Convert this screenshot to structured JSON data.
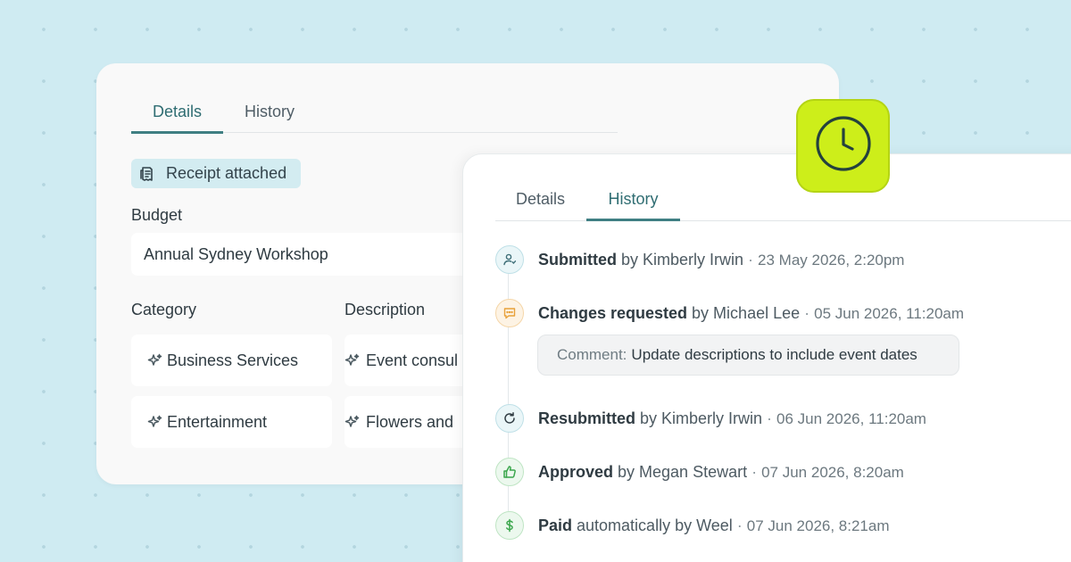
{
  "back_card": {
    "tabs": [
      {
        "label": "Details",
        "active": true
      },
      {
        "label": "History",
        "active": false
      }
    ],
    "receipt_badge": "Receipt attached",
    "budget_label": "Budget",
    "budget_value": "Annual Sydney Workshop",
    "category_label": "Category",
    "description_label": "Description",
    "rows": [
      {
        "category": "Business Services",
        "description": "Event consul"
      },
      {
        "category": "Entertainment",
        "description": "Flowers and"
      }
    ]
  },
  "front_card": {
    "tabs": [
      {
        "label": "Details",
        "active": false
      },
      {
        "label": "History",
        "active": true
      }
    ],
    "events": [
      {
        "icon": "user-icon",
        "action": "Submitted",
        "by": " by Kimberly Irwin",
        "sep": " · ",
        "time": "23 May 2026, 2:20pm"
      },
      {
        "icon": "chat-icon",
        "action": "Changes requested",
        "by": " by Michael Lee",
        "sep": " · ",
        "time": "05 Jun 2026, 11:20am"
      },
      {
        "icon": "refresh-icon",
        "action": "Resubmitted",
        "by": " by Kimberly Irwin",
        "sep": " · ",
        "time": "06 Jun 2026, 11:20am"
      },
      {
        "icon": "thumbs-up-icon",
        "action": "Approved",
        "by": " by Megan Stewart",
        "sep": " · ",
        "time": "07 Jun 2026, 8:20am"
      },
      {
        "icon": "dollar-icon",
        "action": "Paid",
        "by": " automatically by Weel",
        "sep": " · ",
        "time": "07 Jun 2026, 8:21am"
      }
    ],
    "comment": {
      "label": "Comment:",
      "text": "Update descriptions to include event dates"
    }
  },
  "colors": {
    "background": "#cfebf2",
    "accent_teal": "#3f7f83",
    "clock_badge": "#cdee1a",
    "comment_orange": "#e8a13a",
    "success_green": "#3aa64c"
  },
  "badge_icon": "clock-icon"
}
